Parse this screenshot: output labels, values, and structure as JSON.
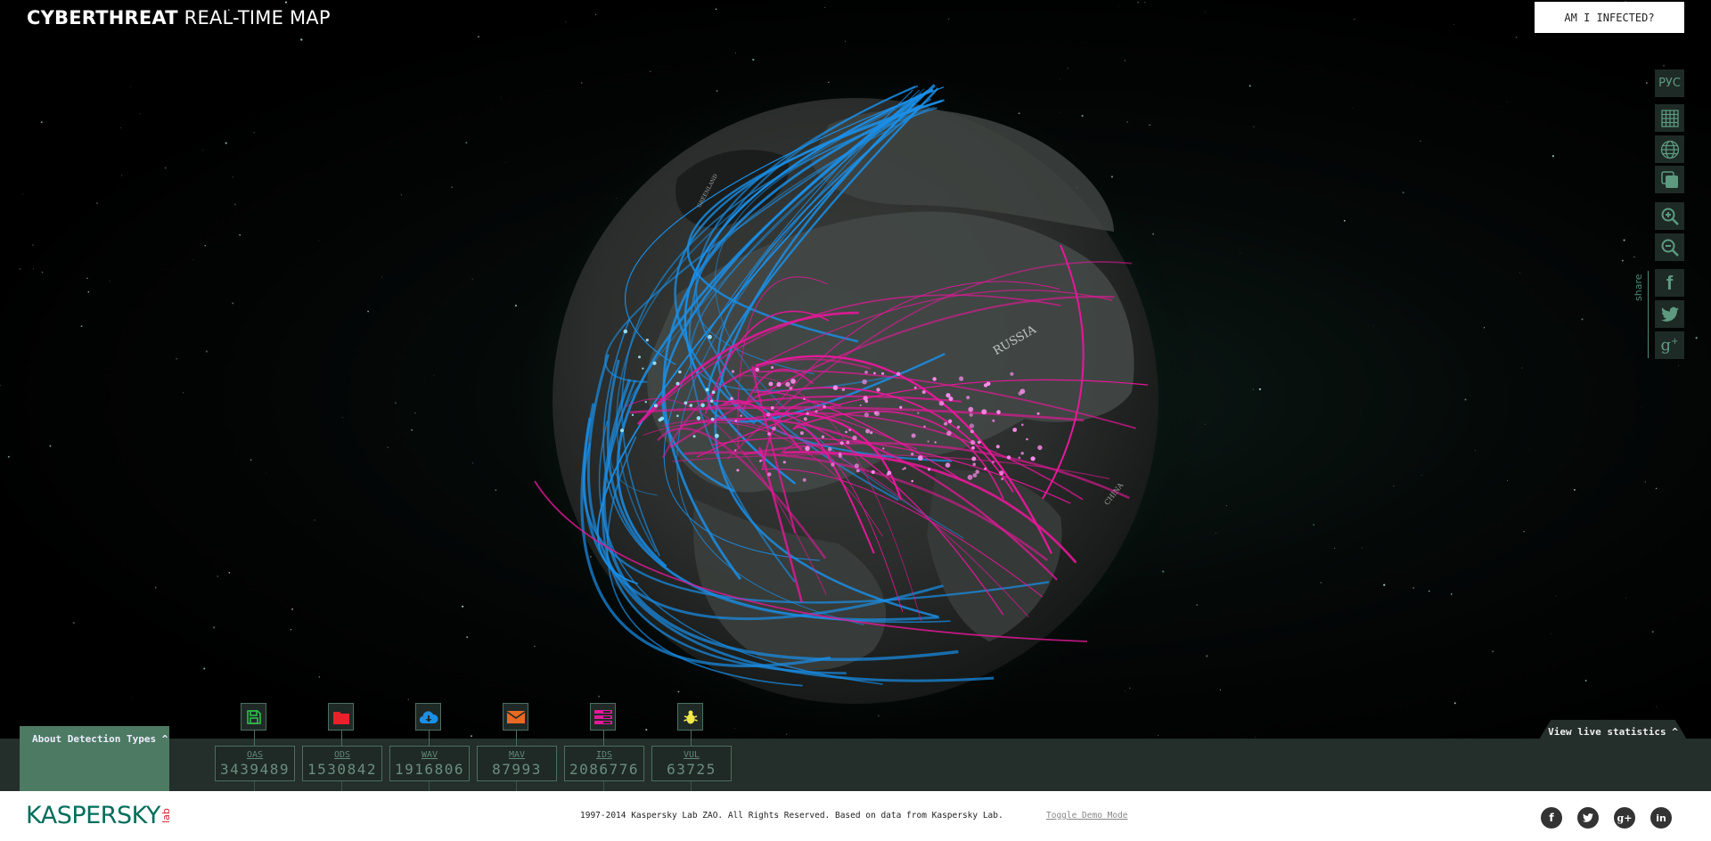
{
  "header": {
    "title_bold": "CYBERTHREAT",
    "title_light": "REAL-TIME MAP",
    "infected_button": "AM I INFECTED?"
  },
  "sidebar": {
    "language_label": "РУС",
    "items": [
      {
        "name": "flat-map-view",
        "icon": "grid-icon"
      },
      {
        "name": "globe-view",
        "icon": "globe-icon"
      },
      {
        "name": "layers-toggle",
        "icon": "layers-icon"
      },
      {
        "name": "zoom-in",
        "icon": "zoom-in-icon"
      },
      {
        "name": "zoom-out",
        "icon": "zoom-out-icon"
      },
      {
        "name": "share-facebook",
        "icon": "facebook-icon"
      },
      {
        "name": "share-twitter",
        "icon": "twitter-icon"
      },
      {
        "name": "share-google-plus",
        "icon": "google-plus-icon"
      }
    ],
    "share_label": "share"
  },
  "map": {
    "country_labels": [
      "RUSSIA",
      "CHINA",
      "GREENLAND"
    ],
    "colors": {
      "oas": "#2fbf4a",
      "ods": "#e8212b",
      "wav": "#1a8fe8",
      "mav": "#e86a22",
      "ids": "#e6189a",
      "vul": "#f0e84a"
    }
  },
  "detections": {
    "about_label": "About Detection Types ^",
    "items": [
      {
        "code": "OAS",
        "value": "3439489",
        "icon": "floppy-disk-icon",
        "color": "#2fbf4a"
      },
      {
        "code": "ODS",
        "value": "1530842",
        "icon": "folder-icon",
        "color": "#e8212b"
      },
      {
        "code": "WAV",
        "value": "1916806",
        "icon": "cloud-download-icon",
        "color": "#1a8fe8"
      },
      {
        "code": "MAV",
        "value": "87993",
        "icon": "envelope-icon",
        "color": "#e86a22"
      },
      {
        "code": "IDS",
        "value": "2086776",
        "icon": "server-icon",
        "color": "#e6189a"
      },
      {
        "code": "VUL",
        "value": "63725",
        "icon": "bug-icon",
        "color": "#f0e84a"
      }
    ],
    "live_stats_label": "View live statistics ^"
  },
  "footer": {
    "logo_text": "KASPERSKY",
    "logo_lab": "lab",
    "copyright": "1997-2014 Kaspersky Lab ZAO. All Rights Reserved. Based on data from Kaspersky Lab.",
    "demo_link": "Toggle Demo Mode",
    "social": [
      {
        "name": "facebook",
        "glyph": "f"
      },
      {
        "name": "twitter",
        "glyph": "t"
      },
      {
        "name": "google-plus",
        "glyph": "g+"
      },
      {
        "name": "linkedin",
        "glyph": "in"
      }
    ]
  }
}
